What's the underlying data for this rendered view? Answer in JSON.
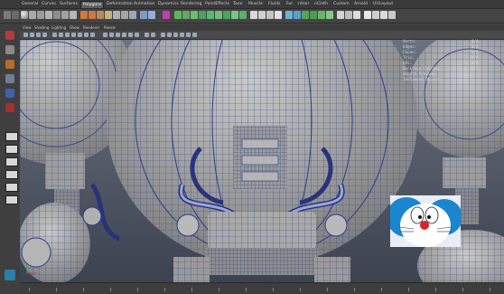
{
  "menu_tabs": [
    "General",
    "Curves",
    "Surfaces",
    "Polygons",
    "Deformation",
    "Animation",
    "Dynamics",
    "Rendering",
    "PaintEffects",
    "Toon",
    "Muscle",
    "Fluids",
    "Fur",
    "nHair",
    "nCloth",
    "Custom",
    "Arnold",
    "UVLayout"
  ],
  "active_tab": "Polygons",
  "panel_menu": [
    "View",
    "Shading",
    "Lighting",
    "Show",
    "Renderer",
    "Panels"
  ],
  "hud_stats": [
    {
      "label": "Verts:",
      "value": "0/4"
    },
    {
      "label": "Edges:",
      "value": "0/4"
    },
    {
      "label": "Faces:",
      "value": "0/4"
    },
    {
      "label": "Tris:",
      "value": "0/4"
    },
    {
      "label": "UVs:",
      "value": "0/4"
    },
    {
      "label": "Backface Culling:",
      "value": "Off"
    },
    {
      "label": "Smooth Preview:",
      "value": ""
    },
    {
      "label": "Instanced Objects:",
      "value": ""
    }
  ],
  "thumbnail_label": "Doraemon"
}
